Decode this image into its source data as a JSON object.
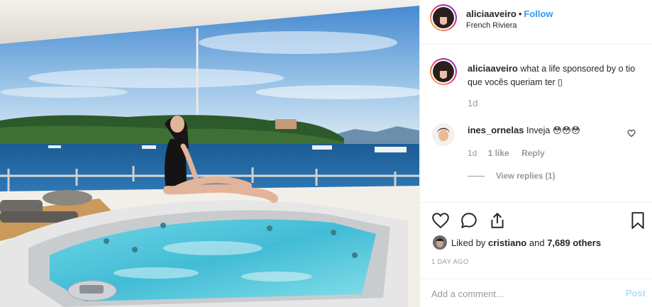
{
  "post": {
    "photo": {
      "description_icon": "jacuzzi-photo"
    }
  },
  "header": {
    "username": "aliciaaveiro",
    "dot": "•",
    "follow_label": "Follow",
    "location": "French Riviera"
  },
  "caption": {
    "username": "aliciaaveiro",
    "text": "what a life sponsored by o tio que vocês queriam ter ▯",
    "time": "1d"
  },
  "comment": {
    "username": "ines_ornelas",
    "text": "Inveja 😳😳😳",
    "time": "1d",
    "likes": "1 like",
    "reply_label": "Reply",
    "view_replies": "View replies (1)"
  },
  "actions": {
    "liked_by_prefix": "Liked by",
    "liked_by_user": "cristiano",
    "liked_by_and": "and",
    "liked_by_others": "7,689 others",
    "date": "1 DAY AGO"
  },
  "add_comment": {
    "placeholder": "Add a comment...",
    "post_label": "Post"
  },
  "colors": {
    "accent": "#3897f0",
    "muted": "#999999",
    "post_disabled": "#b2dffc"
  }
}
